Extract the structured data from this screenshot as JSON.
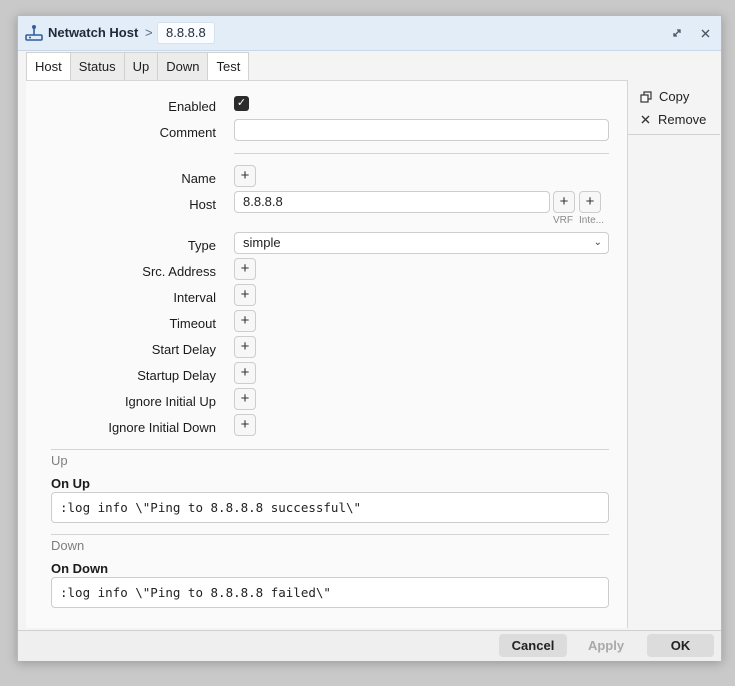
{
  "window": {
    "title": "Netwatch Host",
    "separator": ">",
    "chip": "8.8.8.8"
  },
  "tabs": [
    "Host",
    "Status",
    "Up",
    "Down",
    "Test"
  ],
  "side": {
    "copy": "Copy",
    "remove": "Remove"
  },
  "form": {
    "enabled_label": "Enabled",
    "enabled_checked": true,
    "comment_label": "Comment",
    "comment_value": "",
    "name_label": "Name",
    "host_label": "Host",
    "host_value": "8.8.8.8",
    "vrf_label": "VRF",
    "inte_label": "Inte...",
    "type_label": "Type",
    "type_value": "simple",
    "src_label": "Src. Address",
    "interval_label": "Interval",
    "timeout_label": "Timeout",
    "start_delay_label": "Start Delay",
    "startup_delay_label": "Startup Delay",
    "ignore_up_label": "Ignore Initial Up",
    "ignore_down_label": "Ignore Initial Down"
  },
  "up": {
    "section": "Up",
    "label": "On Up",
    "script": ":log info \\\"Ping to 8.8.8.8 successful\\\""
  },
  "down": {
    "section": "Down",
    "label": "On Down",
    "script": ":log info \\\"Ping to 8.8.8.8 failed\\\""
  },
  "footer": {
    "cancel": "Cancel",
    "apply": "Apply",
    "ok": "OK"
  },
  "colors": {
    "titlebar": "#e3edf8",
    "panel": "#fafafa",
    "apply_disabled": "#a9a9a9"
  }
}
